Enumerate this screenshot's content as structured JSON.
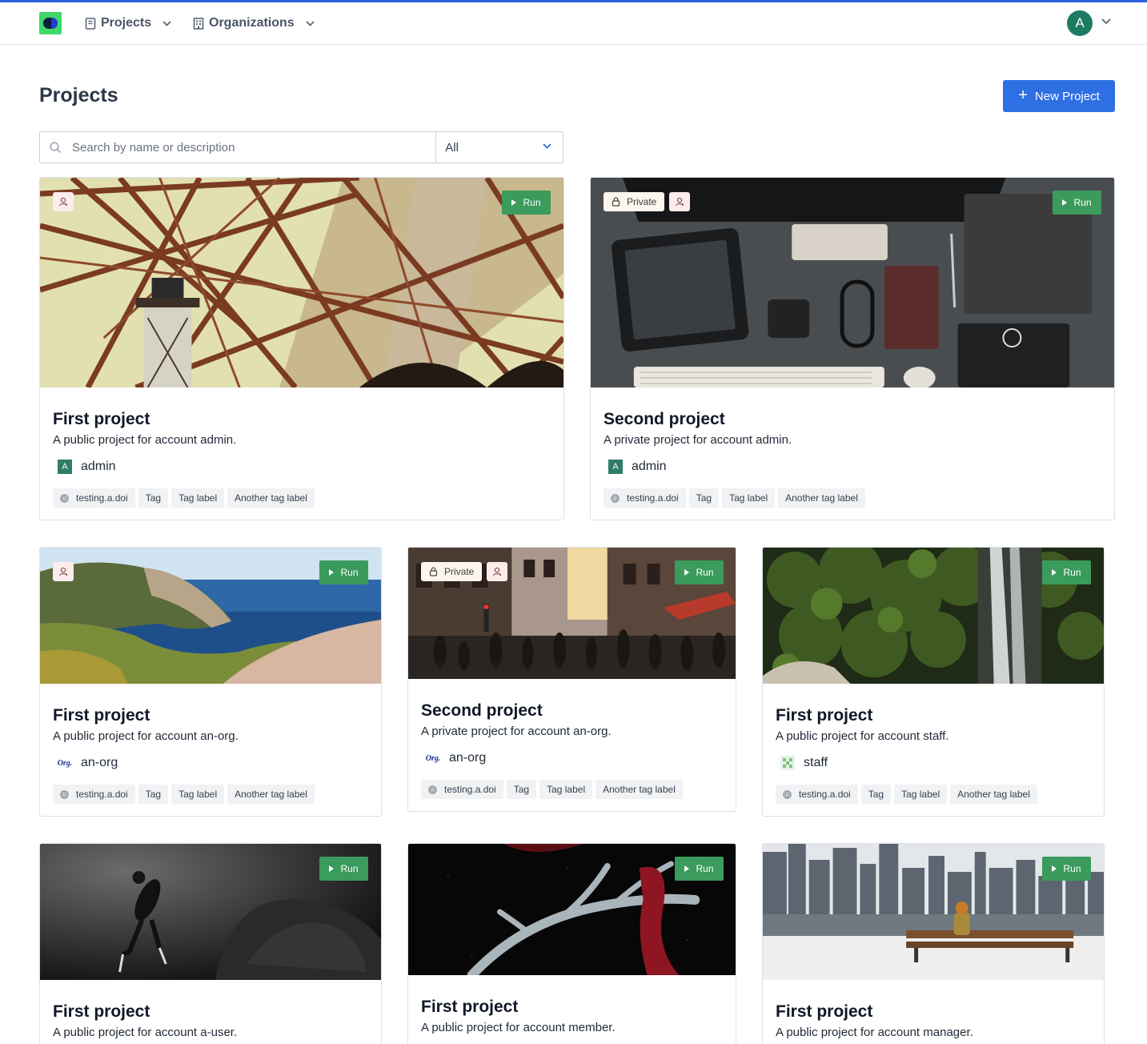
{
  "nav": {
    "projects_label": "Projects",
    "organizations_label": "Organizations",
    "avatar_letter": "A"
  },
  "header": {
    "title": "Projects",
    "new_button_label": "New Project"
  },
  "search": {
    "placeholder": "Search by name or description",
    "value": "",
    "filter_value": "All"
  },
  "run_label": "Run",
  "private_label": "Private",
  "colors": {
    "accent": "#2f6fe4",
    "run_green": "#3a9b5c",
    "top_line": "#2c5fe0"
  },
  "cards": [
    {
      "title": "First project",
      "description": "A public project for account admin.",
      "owner": "admin",
      "owner_avatar": "A",
      "private": false,
      "image": "bridge",
      "tags": [
        "testing.a.doi",
        "Tag",
        "Tag label",
        "Another tag label"
      ]
    },
    {
      "title": "Second project",
      "description": "A private project for account admin.",
      "owner": "admin",
      "owner_avatar": "A",
      "private": true,
      "image": "desk",
      "tags": [
        "testing.a.doi",
        "Tag",
        "Tag label",
        "Another tag label"
      ]
    },
    {
      "title": "First project",
      "description": "A public project for account an-org.",
      "owner": "an-org",
      "owner_avatar": "Org.",
      "private": false,
      "image": "coast",
      "tags": [
        "testing.a.doi",
        "Tag",
        "Tag label",
        "Another tag label"
      ]
    },
    {
      "title": "Second project",
      "description": "A private project for account an-org.",
      "owner": "an-org",
      "owner_avatar": "Org.",
      "private": true,
      "image": "street",
      "tags": [
        "testing.a.doi",
        "Tag",
        "Tag label",
        "Another tag label"
      ]
    },
    {
      "title": "First project",
      "description": "A public project for account staff.",
      "owner": "staff",
      "owner_avatar": "",
      "private": false,
      "image": "waterfall",
      "tags": [
        "testing.a.doi",
        "Tag",
        "Tag label",
        "Another tag label"
      ]
    },
    {
      "title": "First project",
      "description": "A public project for account a-user.",
      "image": "diver"
    },
    {
      "title": "First project",
      "description": "A public project for account member.",
      "image": "antler"
    },
    {
      "title": "First project",
      "description": "A public project for account manager.",
      "image": "city"
    }
  ]
}
